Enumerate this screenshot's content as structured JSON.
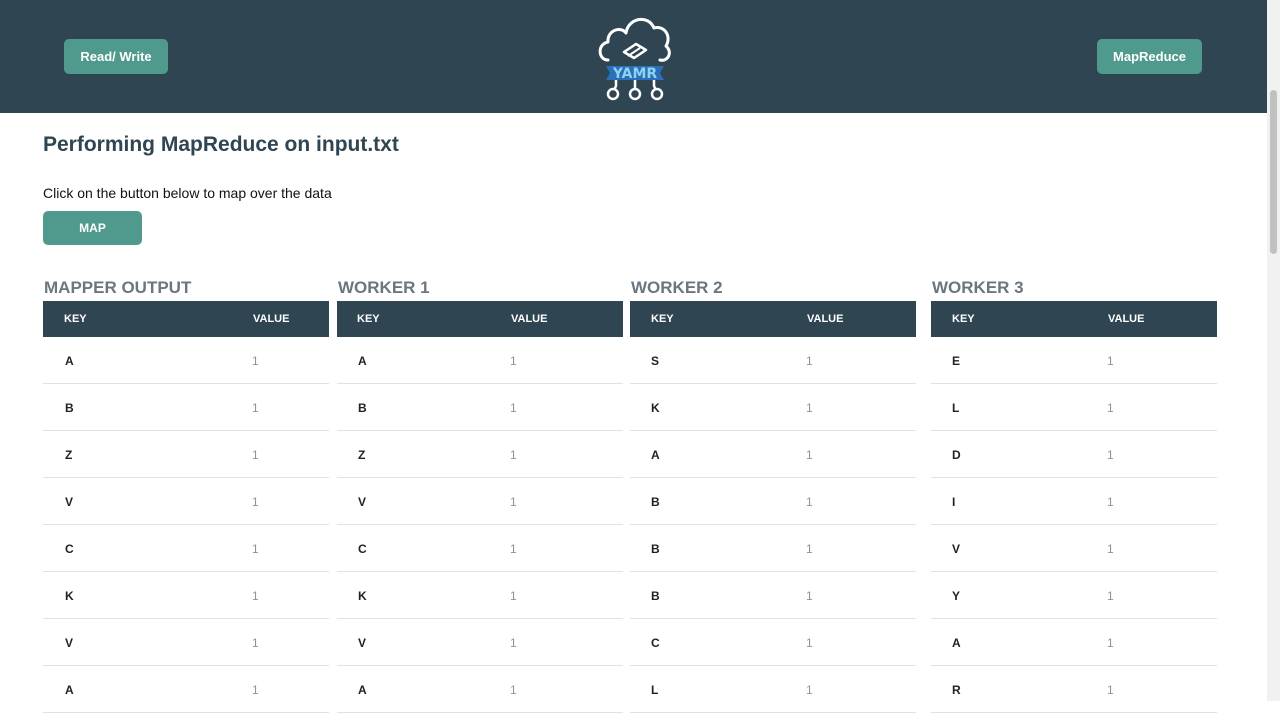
{
  "header": {
    "left_button": "Read/ Write",
    "right_button": "MapReduce",
    "logo_text": "YAMR"
  },
  "page": {
    "title": "Performing MapReduce on input.txt",
    "instruction": "Click on the button below to map over the data",
    "map_button": "MAP"
  },
  "tables": [
    {
      "title": "MAPPER OUTPUT",
      "key_header": "KEY",
      "value_header": "VALUE",
      "rows": [
        {
          "key": "A",
          "value": "1"
        },
        {
          "key": "B",
          "value": "1"
        },
        {
          "key": "Z",
          "value": "1"
        },
        {
          "key": "V",
          "value": "1"
        },
        {
          "key": "C",
          "value": "1"
        },
        {
          "key": "K",
          "value": "1"
        },
        {
          "key": "V",
          "value": "1"
        },
        {
          "key": "A",
          "value": "1"
        }
      ]
    },
    {
      "title": "WORKER 1",
      "key_header": "KEY",
      "value_header": "VALUE",
      "rows": [
        {
          "key": "A",
          "value": "1"
        },
        {
          "key": "B",
          "value": "1"
        },
        {
          "key": "Z",
          "value": "1"
        },
        {
          "key": "V",
          "value": "1"
        },
        {
          "key": "C",
          "value": "1"
        },
        {
          "key": "K",
          "value": "1"
        },
        {
          "key": "V",
          "value": "1"
        },
        {
          "key": "A",
          "value": "1"
        }
      ]
    },
    {
      "title": "WORKER 2",
      "key_header": "KEY",
      "value_header": "VALUE",
      "rows": [
        {
          "key": "S",
          "value": "1"
        },
        {
          "key": "K",
          "value": "1"
        },
        {
          "key": "A",
          "value": "1"
        },
        {
          "key": "B",
          "value": "1"
        },
        {
          "key": "B",
          "value": "1"
        },
        {
          "key": "B",
          "value": "1"
        },
        {
          "key": "C",
          "value": "1"
        },
        {
          "key": "L",
          "value": "1"
        }
      ]
    },
    {
      "title": "WORKER 3",
      "key_header": "KEY",
      "value_header": "VALUE",
      "rows": [
        {
          "key": "E",
          "value": "1"
        },
        {
          "key": "L",
          "value": "1"
        },
        {
          "key": "D",
          "value": "1"
        },
        {
          "key": "I",
          "value": "1"
        },
        {
          "key": "V",
          "value": "1"
        },
        {
          "key": "Y",
          "value": "1"
        },
        {
          "key": "A",
          "value": "1"
        },
        {
          "key": "R",
          "value": "1"
        }
      ]
    }
  ]
}
